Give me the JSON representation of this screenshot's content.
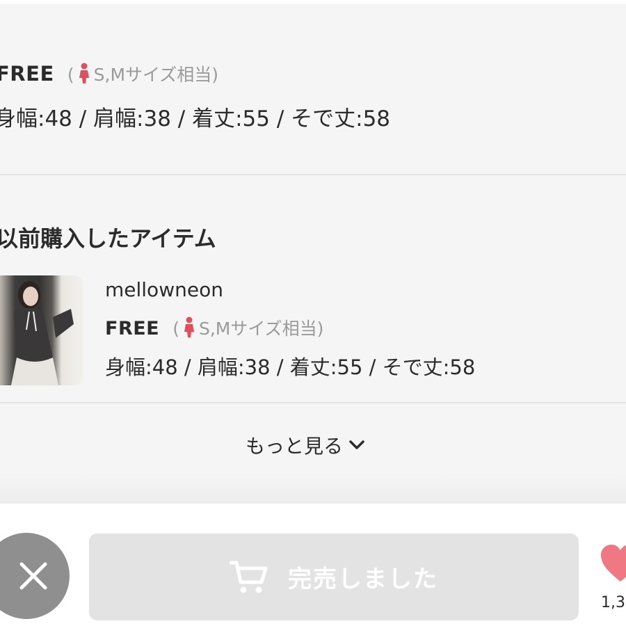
{
  "size_info": {
    "size_label": "FREE",
    "fit_open": "(",
    "fit_text": "S,Mサイズ相当)",
    "measurements": "身幅:48 / 肩幅:38 / 着丈:55 / そで丈:58"
  },
  "previous_purchases": {
    "title": "以前購入したアイテム",
    "items": [
      {
        "brand": "mellowneon",
        "size_label": "FREE",
        "fit_open": "(",
        "fit_text": "S,Mサイズ相当)",
        "measurements": "身幅:48 / 肩幅:38 / 着丈:55 / そで丈:58"
      }
    ],
    "more_label": "もっと見る"
  },
  "bottom_bar": {
    "soldout_label": "完売しました",
    "favorite_count": "1,3"
  },
  "colors": {
    "accent_pink": "#f07882",
    "person_icon": "#e0505a",
    "disabled_button": "#e3e3e3",
    "close_button": "#8f8f8f"
  },
  "icons": {
    "person": "person-icon",
    "chevron": "chevron-down-icon",
    "cart": "cart-icon",
    "close": "close-icon",
    "heart": "heart-icon"
  }
}
